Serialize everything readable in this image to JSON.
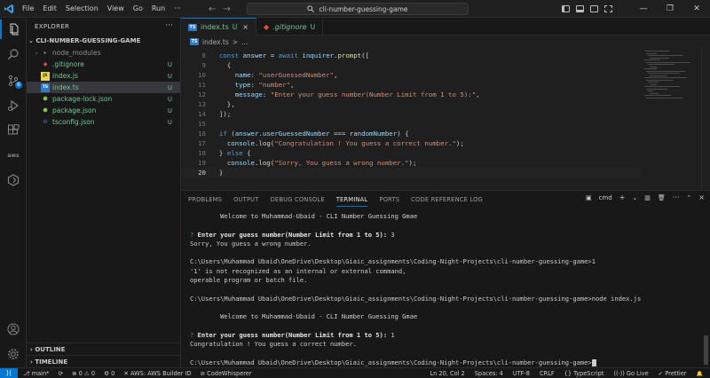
{
  "titlebar": {
    "menu": [
      "File",
      "Edit",
      "Selection",
      "View",
      "Go",
      "Run",
      "···"
    ],
    "search_text": "cli-number-guessing-game",
    "back": "←",
    "forward": "→"
  },
  "sidebar": {
    "title": "EXPLORER",
    "more": "···",
    "folder_name": "CLI-NUMBER-GUESSING-GAME",
    "files": [
      {
        "name": "node_modules",
        "status": ""
      },
      {
        "name": ".gitignore",
        "status": "U"
      },
      {
        "name": "index.js",
        "status": "U"
      },
      {
        "name": "index.ts",
        "status": "U"
      },
      {
        "name": "package-lock.json",
        "status": "U"
      },
      {
        "name": "package.json",
        "status": "U"
      },
      {
        "name": "tsconfig.json",
        "status": "U"
      }
    ],
    "outline": "OUTLINE",
    "timeline": "TIMELINE"
  },
  "activity": {
    "source_control_badge": "6"
  },
  "tabs": [
    {
      "name": "index.ts",
      "status": "U",
      "close": "×"
    },
    {
      "name": ".gitignore",
      "status": "U"
    }
  ],
  "breadcrumb": {
    "file": "index.ts",
    "sep": ">",
    "more": "..."
  },
  "editor": {
    "lines": [
      {
        "n": "8",
        "text": "  const answer = await inquirer.prompt(["
      },
      {
        "n": "9",
        "text": "    {"
      },
      {
        "n": "10",
        "text": "      name: \"userGuessedNumber\","
      },
      {
        "n": "11",
        "text": "      type: \"number\","
      },
      {
        "n": "12",
        "text": "      message: \"Enter your guess number(Number Limit from 1 to 5):\","
      },
      {
        "n": "13",
        "text": "    },"
      },
      {
        "n": "14",
        "text": "  ]);"
      },
      {
        "n": "15",
        "text": ""
      },
      {
        "n": "16",
        "text": "  if (answer.userGuessedNumber === randomNumber) {"
      },
      {
        "n": "17",
        "text": "    console.log(\"Congratulation ! You guess a correct number.\");"
      },
      {
        "n": "18",
        "text": "  } else {"
      },
      {
        "n": "19",
        "text": "    console.log(\"Sorry, You guess a wrong number.\");"
      },
      {
        "n": "20",
        "text": "  }"
      }
    ]
  },
  "panel": {
    "tabs": [
      "PROBLEMS",
      "OUTPUT",
      "DEBUG CONSOLE",
      "TERMINAL",
      "PORTS",
      "CODE REFERENCE LOG"
    ],
    "shell": "cmd",
    "add": "+",
    "more": "···",
    "close": "×"
  },
  "terminal": {
    "welcome1": "        Welcome to Muhammad-Ubaid - CLI Number Guessing Gmae",
    "q_mark": "?",
    "prompt1": " Enter your guess number(Number Limit from 1 to 5):",
    "answer1": " 3",
    "result1": "Sorry, You guess a wrong number.",
    "cmd1": "C:\\Users\\Muhammad Ubaid\\OneDrive\\Desktop\\Giaic_assignments\\Coding-Night-Projects\\cli-number-guessing-game>1",
    "err1": "'1' is not recognized as an internal or external command,",
    "err2": "operable program or batch file.",
    "cmd2": "C:\\Users\\Muhammad Ubaid\\OneDrive\\Desktop\\Giaic_assignments\\Coding-Night-Projects\\cli-number-guessing-game>node index.js",
    "welcome2": "        Welcome to Muhammad-Ubaid - CLI Number Guessing Gmae",
    "prompt2": " Enter your guess number(Number Limit from 1 to 5):",
    "answer2": " 1",
    "result2": "Congratulation ! You guess a correct number.",
    "cmd3": "C:\\Users\\Muhammad Ubaid\\OneDrive\\Desktop\\Giaic_assignments\\Coding-Night-Projects\\cli-number-guessing-game>"
  },
  "statusbar": {
    "branch": "main*",
    "sync": "⟳",
    "errors": "⊗ 0 ⚠ 0",
    "ports": "⚙ 0",
    "aws": "AWS: AWS Builder ID",
    "codewhisperer": "CodeWhisperer",
    "position": "Ln 20, Col 2",
    "spaces": "Spaces: 4",
    "encoding": "UTF-8",
    "eol": "CRLF",
    "language": "{} TypeScript",
    "golive": "Go Live",
    "prettier": "✓ Prettier",
    "bell": "🔔"
  },
  "colors": {
    "accent": "#0078d4",
    "git_untracked": "#73c991",
    "terminal_question": "#32a852"
  }
}
